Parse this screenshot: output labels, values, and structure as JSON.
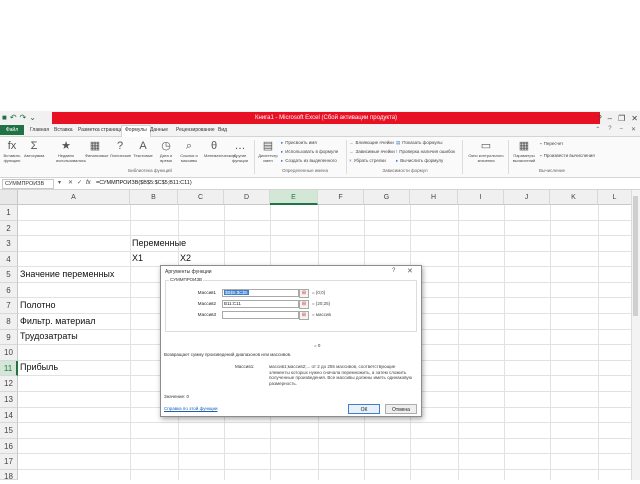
{
  "window": {
    "title": "Книга1 - Microsoft Excel (Сбой активации продукта)",
    "qat": [
      "■",
      "↶",
      "↷",
      "⌄"
    ],
    "controls": [
      "?",
      "–",
      "❐",
      "✕"
    ]
  },
  "tabs": {
    "file": "Файл",
    "items": [
      "Главная",
      "Вставка",
      "Разметка страницы",
      "Формулы",
      "Данные",
      "Рецензирование",
      "Вид"
    ],
    "right": [
      "⌃",
      "?",
      "–",
      "✕"
    ]
  },
  "ribbon": {
    "buttons": [
      {
        "icon": "fx",
        "label": "Вставить функцию"
      },
      {
        "icon": "Σ",
        "label": "Автосумма"
      },
      {
        "icon": "★",
        "label": "Недавно использовались"
      },
      {
        "icon": "▦",
        "label": "Финансовые"
      },
      {
        "icon": "?",
        "label": "Логические"
      },
      {
        "icon": "A",
        "label": "Текстовые"
      },
      {
        "icon": "◷",
        "label": "Дата и время"
      },
      {
        "icon": "⌕",
        "label": "Ссылки и массивы"
      },
      {
        "icon": "θ",
        "label": "Математические"
      },
      {
        "icon": "…",
        "label": "Другие функции"
      },
      {
        "icon": "▤",
        "label": "Диспетчер имен"
      }
    ],
    "group_library": "Библиотека функций",
    "names_items": [
      "Присвоить имя",
      "Использовать в формуле",
      "Создать из выделенного"
    ],
    "group_names": "Определенные имена",
    "audit_items": [
      "Влияющие ячейки",
      "Зависимые ячейки",
      "Убрать стрелки",
      "Показать формулы",
      "Проверка наличия ошибок",
      "Вычислить формулу"
    ],
    "group_audit": "Зависимости формул",
    "watch_label": "Окно контрольного значения",
    "calc_label": "Параметры вычислений",
    "calc_items": [
      "Пересчет",
      "Произвести вычисления"
    ],
    "group_calc": "Вычисление"
  },
  "formula_bar": {
    "name_box": "СУММПРОИЗВ",
    "cancel": "✕",
    "confirm": "✓",
    "fx": "fx",
    "formula": "=СУММПРОИЗВ($B$5:$C$5;B11:C11)"
  },
  "columns": [
    "A",
    "B",
    "C",
    "D",
    "E",
    "F",
    "G",
    "H",
    "I",
    "J",
    "K",
    "L"
  ],
  "rows": [
    "1",
    "2",
    "3",
    "4",
    "5",
    "6",
    "7",
    "8",
    "9",
    "10",
    "11",
    "12",
    "13",
    "14",
    "15",
    "16",
    "17",
    "18"
  ],
  "cells": {
    "b3": "Переменные",
    "b4": "X1",
    "c4": "X2",
    "a5": "Значение переменных",
    "a7": "Полотно",
    "a8": "Фильтр. материал",
    "a9": "Трудозатраты",
    "a11": "Прибыль"
  },
  "dialog": {
    "title": "Аргументы функции",
    "help": "?",
    "close": "✕",
    "legend": "СУММПРОИЗВ",
    "args": [
      {
        "label": "Массив1",
        "value": "$B$5:$C$5",
        "result": "= {0;0}",
        "selected": true
      },
      {
        "label": "Массив2",
        "value": "B11:C11",
        "result": "= {20;25}",
        "selected": false
      },
      {
        "label": "Массив3",
        "value": "",
        "result": "= массив",
        "selected": false
      }
    ],
    "ref_icon": "⊞",
    "result_sum": "= 0",
    "description": "Возвращает сумму произведений диапазонов или массивов.",
    "arg_name": "Массив1:",
    "arg_desc": "массив1;массив2;... от 2 до 255 массивов, соответствующие элементы которых нужно сначала перемножить, а затем сложить полученные произведения. Все массивы должны иметь одинаковую размерность.",
    "value_label": "Значение:   0",
    "help_link": "Справка по этой функции",
    "ok": "ОК",
    "cancel": "Отмена"
  }
}
